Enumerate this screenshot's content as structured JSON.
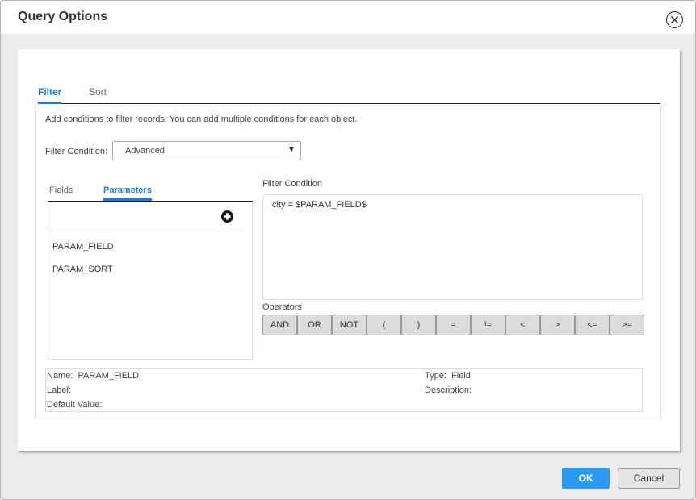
{
  "dialog": {
    "title": "Query Options",
    "close_icon": "close-circle-icon"
  },
  "tabs": [
    {
      "label": "Filter",
      "active": true
    },
    {
      "label": "Sort",
      "active": false
    }
  ],
  "filter": {
    "help_text": "Add conditions to filter records. You can add multiple conditions for each object.",
    "condition_label": "Filter Condition:",
    "condition_select": {
      "value": "Advanced"
    },
    "subtabs": [
      {
        "label": "Fields",
        "active": false
      },
      {
        "label": "Parameters",
        "active": true
      }
    ],
    "add_icon": "plus-circle-icon",
    "parameters": [
      "PARAM_FIELD",
      "PARAM_SORT"
    ],
    "editor_label": "Filter Condition",
    "editor_value": "city = $PARAM_FIELD$",
    "operators_label": "Operators",
    "operators": [
      "AND",
      "OR",
      "NOT",
      "(",
      ")",
      "=",
      "!=",
      "<",
      ">",
      "<=",
      ">="
    ],
    "details": {
      "name_label": "Name:",
      "name_value": "PARAM_FIELD",
      "label_label": "Label:",
      "label_value": "",
      "default_label": "Default Value:",
      "default_value": "",
      "type_label": "Type:",
      "type_value": "Field",
      "description_label": "Description:",
      "description_value": ""
    }
  },
  "footer": {
    "ok_label": "OK",
    "cancel_label": "Cancel",
    "accent_color": "#2b9af3"
  }
}
